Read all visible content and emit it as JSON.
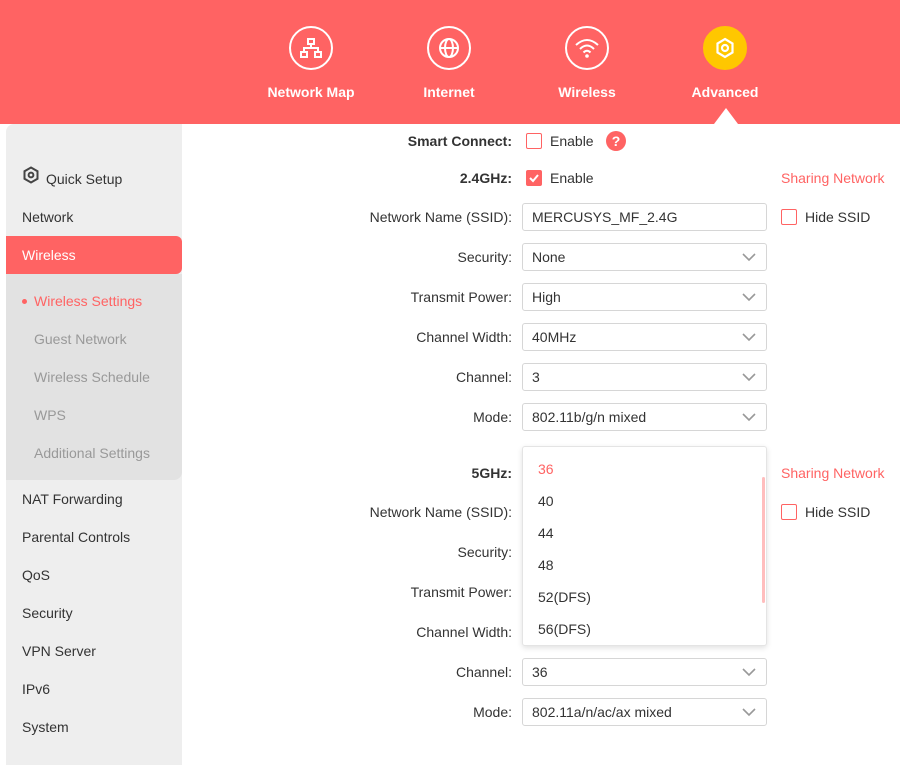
{
  "nav": {
    "items": [
      {
        "label": "Network Map",
        "icon": "network-map-icon"
      },
      {
        "label": "Internet",
        "icon": "globe-icon"
      },
      {
        "label": "Wireless",
        "icon": "wifi-icon"
      },
      {
        "label": "Advanced",
        "icon": "advanced-gear-icon",
        "active": true
      }
    ]
  },
  "sidebar": {
    "items": [
      {
        "label": "Quick Setup",
        "icon": "quick-setup-icon"
      },
      {
        "label": "Network"
      },
      {
        "label": "Wireless",
        "active": true
      },
      {
        "label": "NAT Forwarding"
      },
      {
        "label": "Parental Controls"
      },
      {
        "label": "QoS"
      },
      {
        "label": "Security"
      },
      {
        "label": "VPN Server"
      },
      {
        "label": "IPv6"
      },
      {
        "label": "System"
      }
    ],
    "submenu": [
      {
        "label": "Wireless Settings",
        "active": true
      },
      {
        "label": "Guest Network"
      },
      {
        "label": "Wireless Schedule"
      },
      {
        "label": "WPS"
      },
      {
        "label": "Additional Settings"
      }
    ]
  },
  "form": {
    "smart_connect": {
      "label": "Smart Connect:",
      "checkbox_label": "Enable",
      "checked": false
    },
    "band_24": {
      "label": "2.4GHz:",
      "enable_label": "Enable",
      "enabled": true,
      "sharing_link": "Sharing Network",
      "ssid_label": "Network Name (SSID):",
      "ssid_value": "MERCUSYS_MF_2.4G",
      "hide_ssid_label": "Hide SSID",
      "security_label": "Security:",
      "security_value": "None",
      "power_label": "Transmit Power:",
      "power_value": "High",
      "width_label": "Channel Width:",
      "width_value": "40MHz",
      "channel_label": "Channel:",
      "channel_value": "3",
      "mode_label": "Mode:",
      "mode_value": "802.11b/g/n mixed"
    },
    "band_5": {
      "label": "5GHz:",
      "sharing_link": "Sharing Network",
      "ssid_label": "Network Name (SSID):",
      "hide_ssid_label": "Hide SSID",
      "security_label": "Security:",
      "power_label": "Transmit Power:",
      "width_label": "Channel Width:",
      "channel_label": "Channel:",
      "channel_value": "36",
      "mode_label": "Mode:",
      "mode_value": "802.11a/n/ac/ax mixed"
    }
  },
  "channel_dropdown": {
    "options": [
      "36",
      "40",
      "44",
      "48",
      "52(DFS)",
      "56(DFS)"
    ],
    "selected": "36"
  },
  "colors": {
    "accent": "#ff6363",
    "active_nav": "#ffc700"
  }
}
